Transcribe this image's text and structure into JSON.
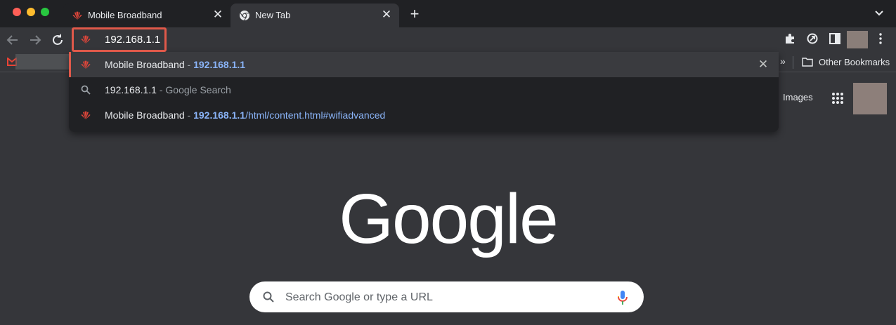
{
  "tabs": [
    {
      "title": "Mobile Broadband",
      "favicon": "huawei-icon",
      "active": false
    },
    {
      "title": "New Tab",
      "favicon": "chrome-icon",
      "active": true
    }
  ],
  "new_tab_glyph": "+",
  "close_glyph": "✕",
  "omnibox": {
    "value": "192.168.1.1"
  },
  "bookmarks": {
    "overflow_glyph": "»",
    "other_label": "Other Bookmarks"
  },
  "suggestions": [
    {
      "title": "Mobile Broadband",
      "sep": " - ",
      "url_bold": "192.168.1.1",
      "url_rest": "",
      "icon": "huawei-icon",
      "selected": true
    },
    {
      "title": "192.168.1.1",
      "sep": " - ",
      "desc": "Google Search",
      "icon": "search-icon"
    },
    {
      "title": "Mobile Broadband",
      "sep": " - ",
      "url_bold": "192.168.1.1",
      "url_rest": "/html/content.html#wifiadvanced",
      "icon": "huawei-icon"
    }
  ],
  "ntp": {
    "images_link": "Images",
    "logo_text": "Google",
    "search_placeholder": "Search Google or type a URL"
  },
  "colors": {
    "accent": "#e0594a",
    "link": "#8ab4f8",
    "background": "#35363a",
    "tabstrip": "#202124"
  }
}
